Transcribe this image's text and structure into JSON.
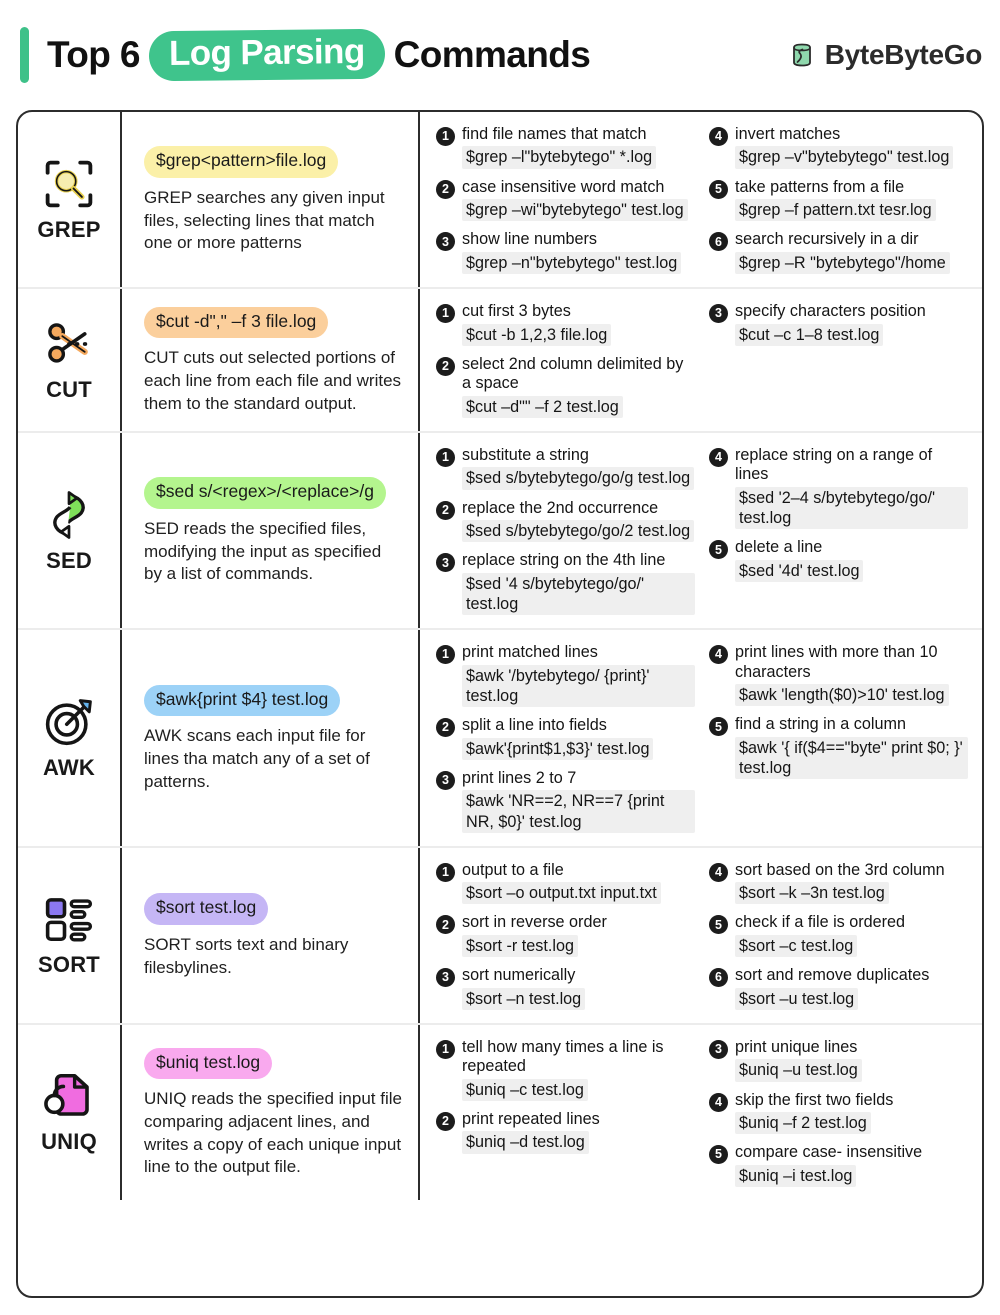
{
  "header": {
    "title_prefix": "Top 6",
    "title_pill": "Log Parsing",
    "title_suffix": "Commands",
    "brand": "ByteByteGo",
    "accent_color": "#3fc48c"
  },
  "rows": [
    {
      "name": "GREP",
      "icon": "magnifier-scan-icon",
      "icon_color": "#e8d04f",
      "highlight": "hl-yellow",
      "syntax": "$grep<pattern>file.log",
      "description": "GREP searches any given input files, selecting lines that match one or more patterns",
      "left": [
        {
          "n": "1",
          "title": "find file names that match",
          "cmd": "$grep –l\"bytebytego\" *.log"
        },
        {
          "n": "2",
          "title": "case insensitive word match",
          "cmd": "$grep –wi\"bytebytego\" test.log"
        },
        {
          "n": "3",
          "title": "show line numbers",
          "cmd": "$grep –n\"bytebytego\" test.log"
        }
      ],
      "right": [
        {
          "n": "4",
          "title": "invert matches",
          "cmd": "$grep –v\"bytebytego\" test.log"
        },
        {
          "n": "5",
          "title": "take patterns from a file",
          "cmd": "$grep –f pattern.txt tesr.log"
        },
        {
          "n": "6",
          "title": "search recursively in a dir",
          "cmd": "$grep –R \"bytebytego\"/home"
        }
      ]
    },
    {
      "name": "CUT",
      "icon": "scissors-icon",
      "icon_color": "#f5a95e",
      "highlight": "hl-orange",
      "syntax": "$cut -d\",\" –f 3 file.log",
      "description": "CUT cuts out selected portions of each line from each file and writes them to the standard output.",
      "left": [
        {
          "n": "1",
          "title": "cut first 3 bytes",
          "cmd": "$cut -b 1,2,3 file.log"
        },
        {
          "n": "2",
          "title": "select 2nd column delimited by a space",
          "cmd": "$cut –d\"\" –f 2 test.log"
        }
      ],
      "right": [
        {
          "n": "3",
          "title": "specify characters position",
          "cmd": "$cut –c 1–8 test.log"
        }
      ]
    },
    {
      "name": "SED",
      "icon": "loop-arrows-icon",
      "icon_color": "#7fe05a",
      "highlight": "hl-green",
      "syntax": "$sed s/<regex>/<replace>/g",
      "description": "SED reads the specified files, modifying the input as specified by a list of commands.",
      "left": [
        {
          "n": "1",
          "title": "substitute a string",
          "cmd": "$sed s/bytebytego/go/g test.log"
        },
        {
          "n": "2",
          "title": "replace the 2nd occurrence",
          "cmd": "$sed s/bytebytego/go/2 test.log"
        },
        {
          "n": "3",
          "title": "replace string on the 4th line",
          "cmd": "$sed '4 s/bytebytego/go/' test.log"
        }
      ],
      "right": [
        {
          "n": "4",
          "title": "replace string on a range of lines",
          "cmd": "$sed '2–4 s/bytebytego/go/' test.log"
        },
        {
          "n": "5",
          "title": "delete a line",
          "cmd": "$sed '4d' test.log"
        }
      ]
    },
    {
      "name": "AWK",
      "icon": "target-arrow-icon",
      "icon_color": "#63b3ed",
      "highlight": "hl-blue",
      "syntax": "$awk{print $4} test.log",
      "description": "AWK scans each input file for lines tha match any of a set of patterns.",
      "left": [
        {
          "n": "1",
          "title": "print matched lines",
          "cmd": "$awk '/bytebytego/ {print}' test.log"
        },
        {
          "n": "2",
          "title": "split a line into fields",
          "cmd": "$awk'{print$1,$3}' test.log"
        },
        {
          "n": "3",
          "title": "print lines 2 to 7",
          "cmd": "$awk 'NR==2, NR==7 {print NR, $0}' test.log"
        }
      ],
      "right": [
        {
          "n": "4",
          "title": "print lines with more than 10 characters",
          "cmd": "$awk 'length($0)>10' test.log"
        },
        {
          "n": "5",
          "title": "find a string in a column",
          "cmd": "$awk '{ if($4==\"byte\" print $0; }' test.log"
        }
      ]
    },
    {
      "name": "SORT",
      "icon": "sort-list-icon",
      "icon_color": "#8b78f0",
      "highlight": "hl-purple",
      "syntax": "$sort test.log",
      "description": "SORT sorts text and binary filesbylines.",
      "left": [
        {
          "n": "1",
          "title": "output to a file",
          "cmd": "$sort –o output.txt input.txt"
        },
        {
          "n": "2",
          "title": "sort in reverse order",
          "cmd": "$sort -r test.log"
        },
        {
          "n": "3",
          "title": "sort numerically",
          "cmd": "$sort –n test.log"
        }
      ],
      "right": [
        {
          "n": "4",
          "title": "sort based on the 3rd column",
          "cmd": "$sort –k –3n test.log"
        },
        {
          "n": "5",
          "title": "check if a file is ordered",
          "cmd": "$sort –c test.log"
        },
        {
          "n": "6",
          "title": "sort and remove duplicates",
          "cmd": "$sort –u test.log"
        }
      ]
    },
    {
      "name": "UNIQ",
      "icon": "document-copy-icon",
      "icon_color": "#f06ce0",
      "highlight": "hl-pink",
      "syntax": "$uniq test.log",
      "description": "UNIQ reads the specified input file comparing adjacent lines, and writes a copy of each unique input line to the output file.",
      "left": [
        {
          "n": "1",
          "title": "tell how many times a line is repeated",
          "cmd": "$uniq –c test.log"
        },
        {
          "n": "2",
          "title": "print repeated lines",
          "cmd": "$uniq –d test.log"
        }
      ],
      "right": [
        {
          "n": "3",
          "title": "print unique lines",
          "cmd": "$uniq –u test.log"
        },
        {
          "n": "4",
          "title": "skip the first two fields",
          "cmd": "$uniq –f 2 test.log"
        },
        {
          "n": "5",
          "title": "compare case- insensitive",
          "cmd": "$uniq –i test.log"
        }
      ]
    }
  ]
}
